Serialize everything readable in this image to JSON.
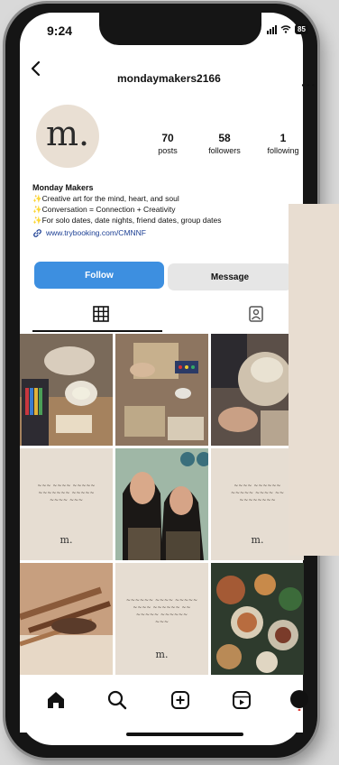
{
  "status_bar": {
    "time": "9:24",
    "battery": "85"
  },
  "header": {
    "username": "mondaymakers2166"
  },
  "profile": {
    "avatar_logo": "m.",
    "stats": [
      {
        "value": "70",
        "label": "posts"
      },
      {
        "value": "58",
        "label": "followers"
      },
      {
        "value": "1",
        "label": "following"
      }
    ],
    "bio": {
      "name": "Monday Makers",
      "lines": [
        "Creative art for the mind, heart, and soul",
        "Conversation = Connection + Creativity",
        "For solo dates, date nights, friend dates, group dates"
      ],
      "link": "www.trybooking.com/CMNNF"
    }
  },
  "actions": {
    "follow_label": "Follow",
    "message_label": "Message"
  },
  "tabs": [
    {
      "icon": "grid-icon"
    },
    {
      "icon": "tagged-icon"
    }
  ],
  "grid_posts": [
    {
      "kind": "photo",
      "icon": "craft-workshop-photo"
    },
    {
      "kind": "photo",
      "icon": "craft-table-photo"
    },
    {
      "kind": "photo",
      "icon": "craft-hands-photo"
    },
    {
      "kind": "quote",
      "logo": "m."
    },
    {
      "kind": "photo",
      "icon": "selfie-photo"
    },
    {
      "kind": "quote",
      "logo": "m."
    },
    {
      "kind": "photo",
      "icon": "brushes-photo"
    },
    {
      "kind": "quote",
      "logo": "m."
    },
    {
      "kind": "photo",
      "icon": "grazing-platter-photo"
    }
  ],
  "bottom_nav": [
    {
      "icon": "home-icon"
    },
    {
      "icon": "search-icon"
    },
    {
      "icon": "create-icon"
    },
    {
      "icon": "reels-icon"
    },
    {
      "icon": "profile-icon"
    }
  ],
  "colors": {
    "accent": "#3d8fe0",
    "beige": "#e8ddd1",
    "link": "#1c3f94"
  }
}
